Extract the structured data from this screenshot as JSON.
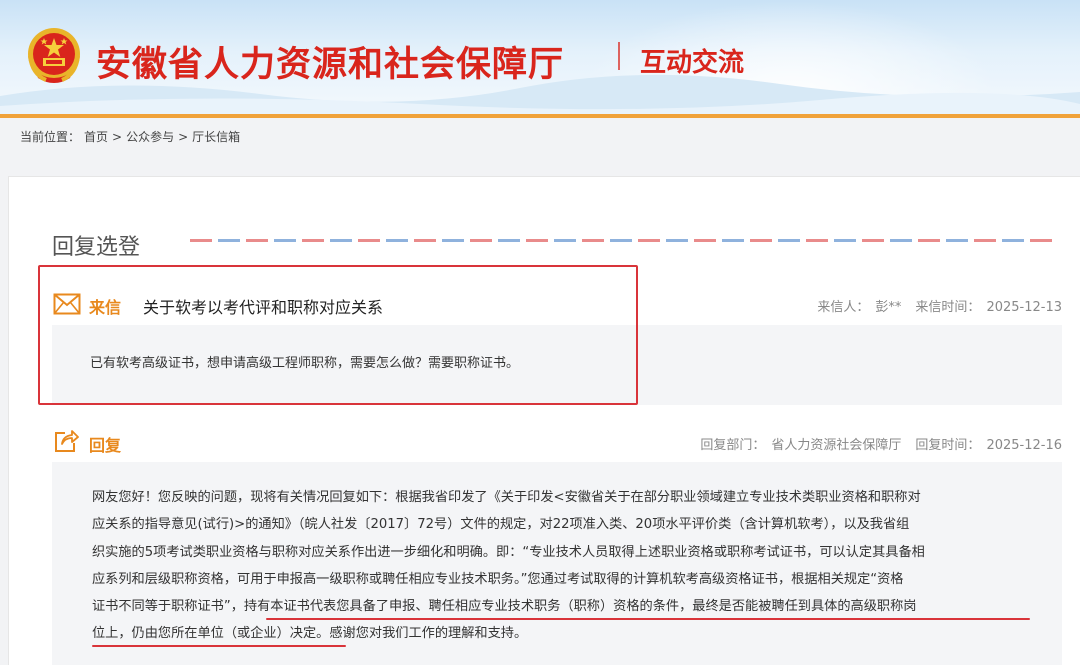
{
  "header": {
    "site_title": "安徽省人力资源和社会保障厅",
    "section_name": "互动交流",
    "emblem_icon": "national-emblem-icon"
  },
  "breadcrumb": {
    "prefix": "当前位置：",
    "items": [
      "首页",
      "公众参与",
      "厅长信箱"
    ],
    "separator": ">"
  },
  "main": {
    "heading": "回复选登",
    "letter": {
      "icon": "envelope-icon",
      "label": "来信",
      "subject": "关于软考以考代评和职称对应关系",
      "sender_label": "来信人：",
      "sender": "彭**",
      "date_label": "来信时间：",
      "date": "2025-12-13",
      "body": "已有软考高级证书，想申请高级工程师职称，需要怎么做？需要职称证书。"
    },
    "reply": {
      "icon": "share-reply-icon",
      "label": "回复",
      "dept_label": "回复部门：",
      "dept": "省人力资源社会保障厅",
      "date_label": "回复时间：",
      "date": "2025-12-16",
      "lines": [
        "网友您好！您反映的问题，现将有关情况回复如下：根据我省印发了《关于印发<安徽省关于在部分职业领域建立专业技术类职业资格和职称对",
        "应关系的指导意见(试行)>的通知》（皖人社发〔2017〕72号）文件的规定，对22项准入类、20项水平评价类（含计算机软考），以及我省组",
        "织实施的5项考试类职业资格与职称对应关系作出进一步细化和明确。即：“专业技术人员取得上述职业资格或职称考试证书，可以认定其具备相",
        "应系列和层级职称资格，可用于申报高一级职称或聘任相应专业技术职务。”您通过考试取得的计算机软考高级资格证书，根据相关规定“资格",
        "证书不同等于职称证书”，持有本证书代表您具备了申报、聘任相应专业技术职务（职称）资格的条件，最终是否能被聘任到具体的高级职称岗",
        "位上，仍由您所在单位（或企业）决定。感谢您对我们工作的理解和支持。"
      ]
    }
  },
  "colors": {
    "brand_red": "#d9251c",
    "accent_orange": "#e8891e",
    "highlight_red": "#d9343a"
  }
}
